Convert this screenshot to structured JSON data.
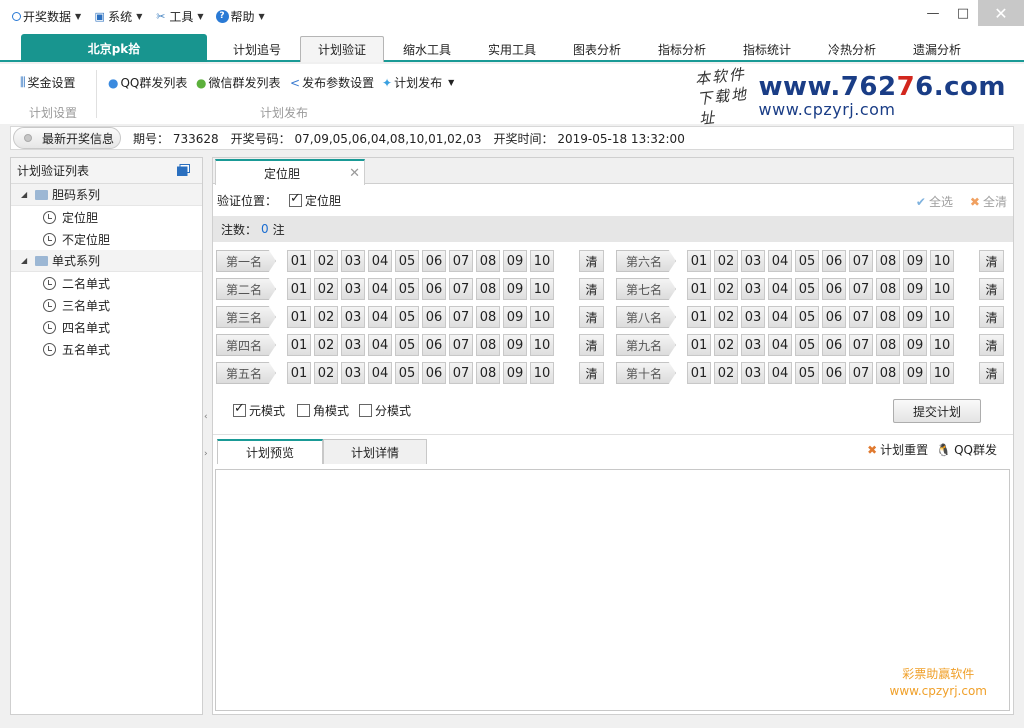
{
  "menu": {
    "items": [
      {
        "label": "开奖数据",
        "icon": "circle-icon"
      },
      {
        "label": "系统",
        "icon": "monitor-icon"
      },
      {
        "label": "工具",
        "icon": "tools-icon"
      },
      {
        "label": "帮助",
        "icon": "help-icon"
      }
    ],
    "minimize": "—",
    "maximize": "□",
    "close": "✕"
  },
  "tabs": {
    "main": "北京pk拾",
    "items": [
      "计划追号",
      "计划验证",
      "缩水工具",
      "实用工具",
      "图表分析",
      "指标分析",
      "指标统计",
      "冷热分析",
      "遗漏分析"
    ],
    "active": "计划验证"
  },
  "toolbar": {
    "prize_settings": "奖金设置",
    "group1_label": "计划设置",
    "qq_list": "QQ群发列表",
    "wechat_list": "微信群发列表",
    "publish_params": "发布参数设置",
    "plan_publish": "计划发布",
    "group2_label": "计划发布"
  },
  "logo": {
    "script_line1": "本软件",
    "script_line2": "下载地址",
    "main_a": "www.762",
    "main_b": "7",
    "main_c": "6.com",
    "sub": "www.cpzyrj.com"
  },
  "info": {
    "button": "最新开奖信息",
    "issue_label": "期号：",
    "issue": "733628",
    "numbers_label": "开奖号码：",
    "numbers": "07,09,05,06,04,08,10,01,02,03",
    "time_label": "开奖时间：",
    "time": "2019-05-18 13:32:00"
  },
  "left": {
    "title": "计划验证列表",
    "groups": [
      {
        "label": "胆码系列",
        "items": [
          "定位胆",
          "不定位胆"
        ]
      },
      {
        "label": "单式系列",
        "items": [
          "二名单式",
          "三名单式",
          "四名单式",
          "五名单式"
        ]
      }
    ]
  },
  "main": {
    "tab": "定位胆",
    "close": "✕",
    "verify_label": "验证位置：",
    "verify_option": "定位胆",
    "select_all": "全选",
    "clear_all": "全清",
    "count_label": "注数：",
    "count": "0",
    "count_unit": "注",
    "left_ranks": [
      "第一名",
      "第二名",
      "第三名",
      "第四名",
      "第五名"
    ],
    "right_ranks": [
      "第六名",
      "第七名",
      "第八名",
      "第九名",
      "第十名"
    ],
    "numbers": [
      "01",
      "02",
      "03",
      "04",
      "05",
      "06",
      "07",
      "08",
      "09",
      "10"
    ],
    "clear_btn": "清",
    "modes": [
      {
        "label": "元模式",
        "checked": true
      },
      {
        "label": "角模式",
        "checked": false
      },
      {
        "label": "分模式",
        "checked": false
      }
    ],
    "submit": "提交计划",
    "bottom_tabs": [
      "计划预览",
      "计划详情"
    ],
    "reset": "计划重置",
    "qq_send": "QQ群发",
    "watermark_1": "彩票助赢软件",
    "watermark_2": "www.cpzyrj.com"
  }
}
